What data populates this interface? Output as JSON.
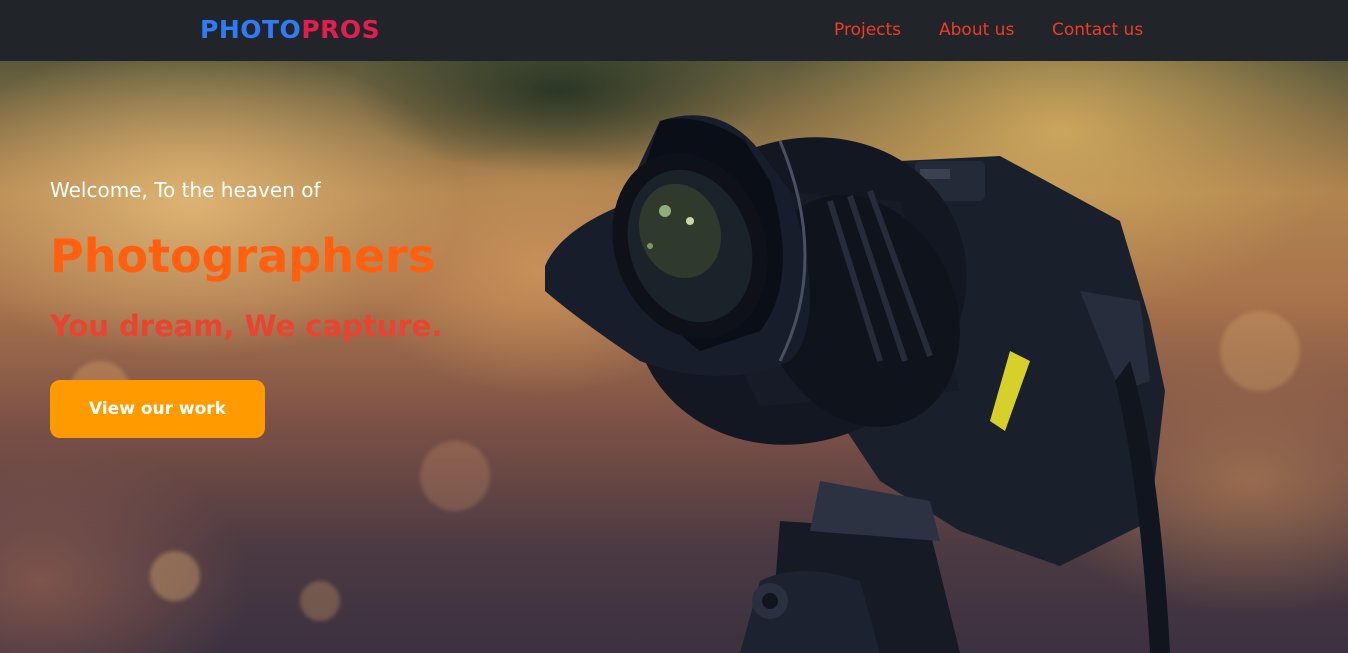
{
  "navbar": {
    "logo": {
      "part1": "PHOTO",
      "part2": "PROS"
    },
    "links": [
      {
        "label": "Projects"
      },
      {
        "label": "About us"
      },
      {
        "label": "Contact us"
      }
    ]
  },
  "hero": {
    "welcome": "Welcome, To the heaven of",
    "headline": "Photographers",
    "tagline": "You dream, We capture.",
    "cta_label": "View our work"
  },
  "colors": {
    "navbar_bg": "#212529",
    "logo_photo": "#2f7cf6",
    "logo_pros": "#e21e4f",
    "nav_link": "#ef3b2c",
    "headline": "#ff5f0f",
    "tagline": "#e8442f",
    "cta_bg": "#ff9a00"
  }
}
